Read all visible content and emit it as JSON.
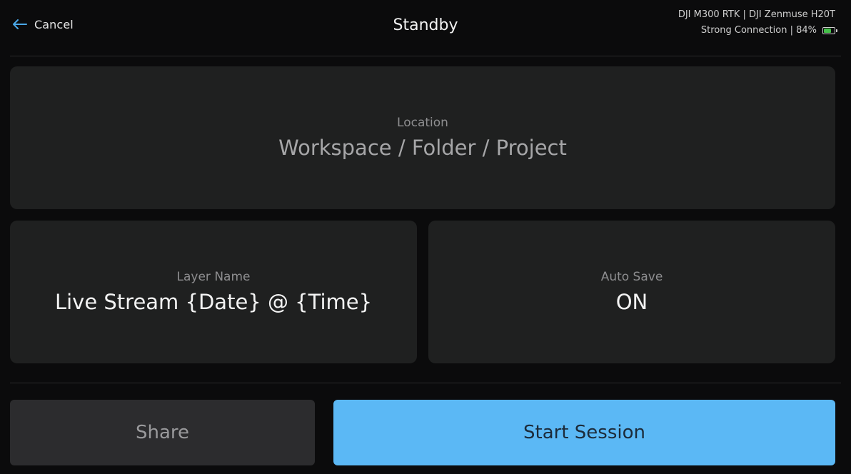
{
  "header": {
    "cancel_label": "Cancel",
    "title": "Standby",
    "device": "DJI M300 RTK | DJI Zenmuse H20T",
    "connection_status": "Strong Connection | 84%",
    "battery_percent": 84,
    "battery_color": "#45c14a"
  },
  "location": {
    "label": "Location",
    "value": "Workspace / Folder / Project"
  },
  "layer": {
    "label": "Layer Name",
    "value": "Live Stream {Date} @ {Time}"
  },
  "autosave": {
    "label": "Auto Save",
    "value": "ON"
  },
  "actions": {
    "share_label": "Share",
    "start_label": "Start Session",
    "start_color": "#5bb8f5"
  },
  "icons": {
    "back": "arrow-left-icon",
    "battery": "battery-icon"
  }
}
